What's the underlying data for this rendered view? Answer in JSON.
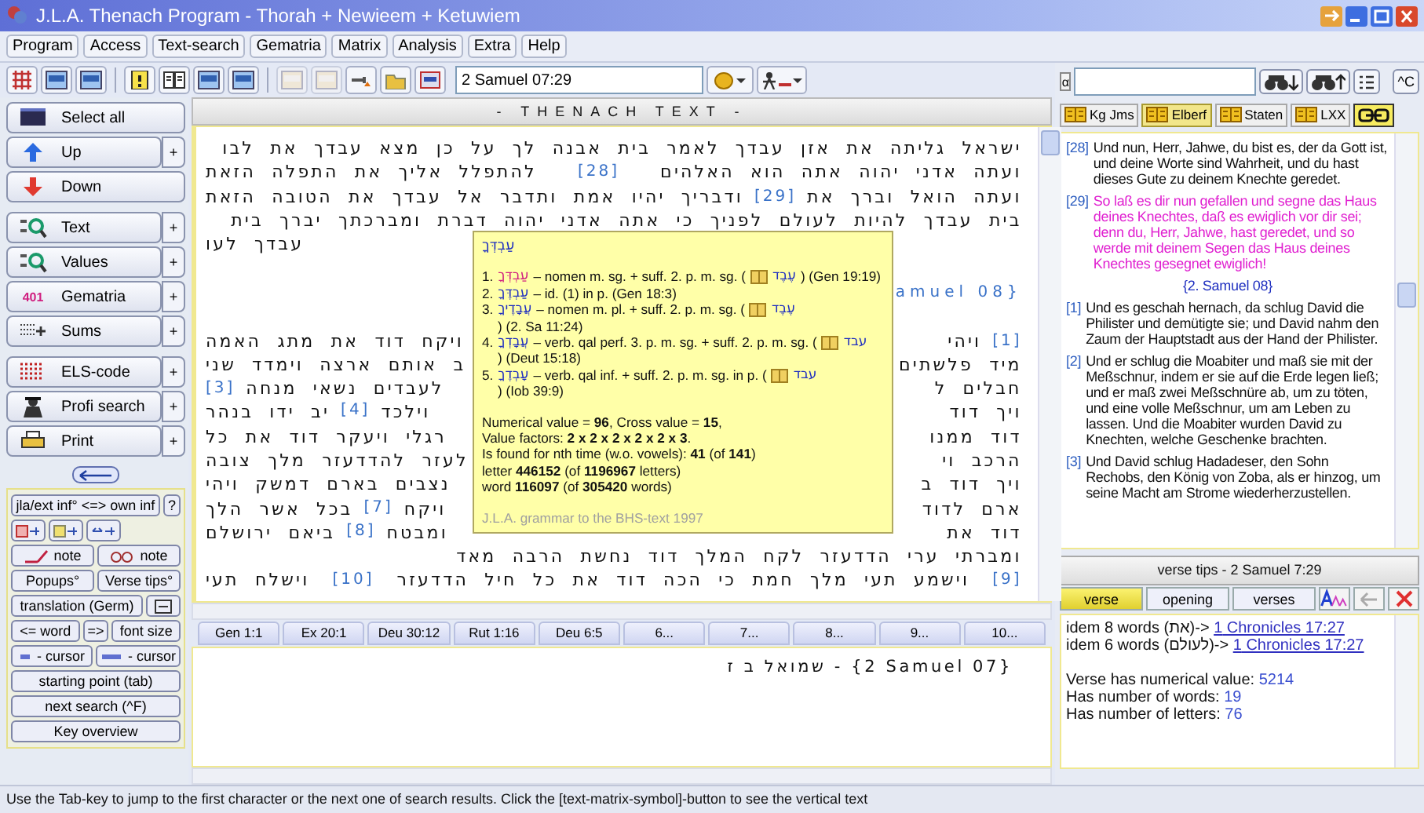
{
  "window": {
    "title": "J.L.A. Thenach Program - Thorah + Newieem + Ketuwiem"
  },
  "menu": [
    "Program",
    "Access",
    "Text-search",
    "Gematria",
    "Matrix",
    "Analysis",
    "Extra",
    "Help"
  ],
  "toolbar_groups": [
    [
      {
        "disabled": false
      },
      {
        "disabled": false
      },
      {
        "disabled": false
      }
    ],
    [
      {
        "disabled": false
      },
      {
        "disabled": false
      },
      {
        "disabled": false
      },
      {
        "disabled": false
      }
    ],
    [
      {
        "disabled": true
      },
      {
        "disabled": true
      },
      {
        "disabled": false
      },
      {
        "disabled": false
      },
      {
        "disabled": false
      }
    ]
  ],
  "reference_field": {
    "value": "2 Samuel 07:29"
  },
  "sidebar_groups": [
    [
      {
        "label": "Select all"
      },
      {
        "label": "Up",
        "more": "+"
      },
      {
        "label": "Down"
      }
    ],
    [
      {
        "label": "Text",
        "more": "+"
      },
      {
        "label": "Values",
        "more": "+"
      },
      {
        "label": "Gematria",
        "more": "+",
        "badge": "401"
      },
      {
        "label": "Sums",
        "more": "+"
      }
    ],
    [
      {
        "label": "ELS-code",
        "more": "+"
      },
      {
        "label": "Profi search",
        "more": "+"
      },
      {
        "label": "Print",
        "more": "+"
      }
    ]
  ],
  "tool_rows": [
    [
      {
        "kind": "text",
        "label": "jla/ext inf° <=> own inf"
      },
      {
        "kind": "text",
        "label": "?"
      }
    ],
    [
      {
        "kind": "icon"
      },
      {
        "kind": "icon"
      },
      {
        "kind": "icon"
      }
    ],
    [
      {
        "kind": "icon-text",
        "label": "note"
      },
      {
        "kind": "icon-text",
        "label": "note"
      }
    ],
    [
      {
        "kind": "text",
        "label": "Popups°"
      },
      {
        "kind": "text",
        "label": "Verse tips°"
      }
    ],
    [
      {
        "kind": "text",
        "label": "translation (Germ)"
      },
      {
        "kind": "icon"
      }
    ],
    [
      {
        "kind": "text",
        "label": "<= word"
      },
      {
        "kind": "text",
        "label": "=>"
      },
      {
        "kind": "text",
        "label": "font size"
      }
    ],
    [
      {
        "kind": "icon-text",
        "label": "- cursor"
      },
      {
        "kind": "icon-text",
        "label": "- cursor"
      }
    ],
    [
      {
        "kind": "text",
        "label": "starting point (tab)"
      }
    ],
    [
      {
        "kind": "text",
        "label": "next search (^F)"
      }
    ],
    [
      {
        "kind": "text",
        "label": "Key overview"
      }
    ]
  ],
  "text_header": "- THENACH TEXT -",
  "text_rows": [
    {
      "kind": "full",
      "parts": [
        {
          "kind": "text",
          "text": "ישראל גליתה את אזן עבדך לאמר בית אבנה לך על כן מצא עבדך את לבו"
        }
      ]
    },
    {
      "kind": "full",
      "parts": [
        {
          "kind": "text",
          "text": "ועתה אדני יהוה אתה הוא האלהים"
        },
        {
          "kind": "verse",
          "text": "[28]"
        },
        {
          "kind": "text",
          "text": "להתפלל אליך את התפלה הזאת"
        }
      ]
    },
    {
      "kind": "full",
      "parts": [
        {
          "kind": "text",
          "text": "ועתה הואל וברך את"
        },
        {
          "kind": "verse",
          "text": "[29]"
        },
        {
          "kind": "text",
          "text": "ודבריך יהיו אמת ותדבר אל עבדך את הטובה הזאת"
        }
      ]
    },
    {
      "kind": "full",
      "parts": [
        {
          "kind": "text",
          "text": "בית עבדך להיות לעולם לפניך כי אתה אדני יהוה דברת ומברכתך יברך בית"
        }
      ]
    },
    {
      "kind": "split",
      "right": [],
      "left": [
        {
          "kind": "text",
          "text": "עבדך לעו"
        }
      ]
    },
    {
      "kind": "blank"
    },
    {
      "kind": "heading",
      "text": "amuel 08}"
    },
    {
      "kind": "blank"
    },
    {
      "kind": "split",
      "lead": "[1]",
      "right": [
        {
          "kind": "text",
          "text": "ויהי"
        }
      ],
      "left": [
        {
          "kind": "text",
          "text": "ויקח דוד את מתג האמה"
        }
      ]
    },
    {
      "kind": "split",
      "right": [
        {
          "kind": "text",
          "text": "מיד פלשתים"
        }
      ],
      "left": [
        {
          "kind": "text",
          "text": "ב אותם ארצה וימדד שני"
        }
      ]
    },
    {
      "kind": "split",
      "right": [
        {
          "kind": "text",
          "text": "חבלים ל"
        }
      ],
      "left": [
        {
          "kind": "text",
          "text": "לעבדים נשאי מנחה"
        }
      ],
      "tail": "[3]"
    },
    {
      "kind": "split",
      "right": [
        {
          "kind": "text",
          "text": "ויך דוד"
        }
      ],
      "left": [
        {
          "kind": "text",
          "text": "וילכד"
        },
        {
          "kind": "verse",
          "text": "[4]"
        },
        {
          "kind": "text",
          "text": "יב ידו בנהר"
        }
      ]
    },
    {
      "kind": "split",
      "right": [
        {
          "kind": "text",
          "text": "דוד ממנו"
        }
      ],
      "left": [
        {
          "kind": "text",
          "text": "רגלי ויעקר דוד את כל"
        }
      ]
    },
    {
      "kind": "split",
      "right": [
        {
          "kind": "text",
          "text": "הרכב וי"
        }
      ],
      "left": [
        {
          "kind": "text",
          "text": "לעזר להדדעזר מלך צובה"
        }
      ]
    },
    {
      "kind": "split",
      "right": [
        {
          "kind": "text",
          "text": "ויך דוד ב"
        }
      ],
      "left": [
        {
          "kind": "text",
          "text": "נצבים בארם דמשק ויהי"
        }
      ]
    },
    {
      "kind": "split",
      "right": [
        {
          "kind": "text",
          "text": "ארם לדוד"
        }
      ],
      "left": [
        {
          "kind": "text",
          "text": "ויקח"
        },
        {
          "kind": "verse",
          "text": "[7]"
        },
        {
          "kind": "text",
          "text": "בכל אשר הלך"
        }
      ]
    },
    {
      "kind": "split",
      "right": [
        {
          "kind": "text",
          "text": "דוד את"
        }
      ],
      "left": [
        {
          "kind": "text",
          "text": "ומבטח"
        },
        {
          "kind": "verse",
          "text": "[8]"
        },
        {
          "kind": "text",
          "text": "ביאם ירושלם"
        }
      ]
    },
    {
      "kind": "end",
      "parts": [
        {
          "kind": "text",
          "text": "ומברתי ערי הדדעזר לקח המלך דוד נחשת הרבה מאד"
        }
      ]
    },
    {
      "kind": "full",
      "lead": "[9]",
      "parts": [
        {
          "kind": "text",
          "text": "וישמע תעי מלך חמת כי הכה דוד את כל חיל הדדעזר"
        },
        {
          "kind": "verse",
          "text": "[10]"
        },
        {
          "kind": "text",
          "text": "וישלח תעי"
        }
      ]
    }
  ],
  "popup": {
    "word": "עַבְדְּךָ",
    "entries": [
      {
        "num": "1.",
        "form": "עַבְדְּךָ",
        "highlight": true,
        "desc": "– nomen m. sg. + suff. 2. p. m. sg. (",
        "root": "עֶבֶד",
        "ref": ") (Gen 19:19)"
      },
      {
        "num": "2.",
        "form": "עַבְדֶּךָ",
        "highlight": false,
        "desc": "– id. (1) in p. (Gen 18:3)"
      },
      {
        "num": "3.",
        "form": "עֲבָדֶיךָ",
        "highlight": false,
        "desc": "– nomen m. pl. + suff. 2. p. m. sg. (",
        "root": "עֶבֶד",
        "ref": ") (2. Sa 11:24)"
      },
      {
        "num": "4.",
        "form": "עֲבָדְךָ",
        "highlight": false,
        "desc": "– verb. qal perf. 3. p. m. sg. + suff. 2. p. m. sg. (",
        "root": "עבד",
        "ref": ") (Deut 15:18)"
      },
      {
        "num": "5.",
        "form": "עָבְדֶךָ",
        "highlight": false,
        "desc": "– verb. qal inf. + suff. 2. p. m. sg. in p. (",
        "root": "עבד",
        "ref": ") (Iob 39:9)"
      }
    ],
    "stats": [
      "Numerical value = **96**, Cross value = **15**,",
      "Value factors: **2 x 2 x 2 x 2 x 2 x 3**.",
      "Is found for nth time (w.o. vowels): **41** (of **141**)",
      "letter **446152** (of **1196967** letters)",
      "word **116097** (of **305420** words)"
    ],
    "footer": "J.L.A. grammar to the BHS-text 1997"
  },
  "bookmark_tabs": [
    "Gen 1:1",
    "Ex 20:1",
    "Deu 30:12",
    "Rut 1:16",
    "Deu 6:5",
    "6...",
    "7...",
    "8...",
    "9...",
    "10..."
  ],
  "bottom_pane": {
    "line": "שמואל ב ז - {2 Samuel 07}"
  },
  "search": {
    "prefix": "α",
    "copy_button": "^C"
  },
  "translations": [
    {
      "label": "Kg Jms",
      "selected": false
    },
    {
      "label": "Elberf",
      "selected": true
    },
    {
      "label": "Staten",
      "selected": false
    },
    {
      "label": "LXX",
      "selected": false
    }
  ],
  "translation_text": [
    {
      "kind": "verse",
      "num": "[28]",
      "text": "Und nun, Herr, Jahwe, du bist es, der da Gott ist, und deine Worte sind Wahrheit, und du hast dieses Gute zu deinem Knechte geredet.",
      "highlight": false
    },
    {
      "kind": "verse",
      "num": "[29]",
      "text": "So laß es dir nun gefallen und segne das Haus deines Knechtes, daß es ewiglich vor dir sei; denn du, Herr, Jahwe, hast geredet, und so werde mit deinem Segen das Haus deines Knechtes gesegnet ewiglich!",
      "highlight": true
    },
    {
      "kind": "heading",
      "text": "{2. Samuel 08}"
    },
    {
      "kind": "verse",
      "num": "[1]",
      "text": "Und es geschah hernach, da schlug David die Philister und demütigte sie; und David nahm den Zaum der Hauptstadt aus der Hand der Philister.",
      "highlight": false
    },
    {
      "kind": "verse",
      "num": "[2]",
      "text": "Und er schlug die Moabiter und maß sie mit der Meßschnur, indem er sie auf die Erde legen ließ; und er maß zwei Meßschnüre ab, um zu töten, und eine volle Meßschnur, um am Leben zu lassen. Und die Moabiter wurden David zu Knechten, welche Geschenke brachten.",
      "highlight": false
    },
    {
      "kind": "verse",
      "num": "[3]",
      "text": "Und David schlug Hadadeser, den Sohn Rechobs, den König von Zoba, als er hinzog, um seine Macht am Strome wiederherzustellen.",
      "highlight": false
    }
  ],
  "verse_tips": {
    "title": "verse tips - 2 Samuel 7:29",
    "tabs": [
      {
        "label": "verse",
        "selected": true
      },
      {
        "label": "opening",
        "selected": false
      },
      {
        "label": "verses",
        "selected": false
      }
    ],
    "links": [
      {
        "text": "idem 8 words (את)->",
        "link": "1 Chronicles 17:27"
      },
      {
        "text": "idem 6 words (לעולם)->",
        "link": "1 Chronicles 17:27"
      }
    ],
    "facts": [
      {
        "label": "Verse has numerical value:",
        "value": "5214"
      },
      {
        "label": "Has number of words:",
        "value": "19"
      },
      {
        "label": "Has number of letters:",
        "value": "76"
      }
    ]
  },
  "status_bar": "Use the Tab-key to jump to the first character or the next one of search results. Click the [text-matrix-symbol]-button to see the vertical text"
}
